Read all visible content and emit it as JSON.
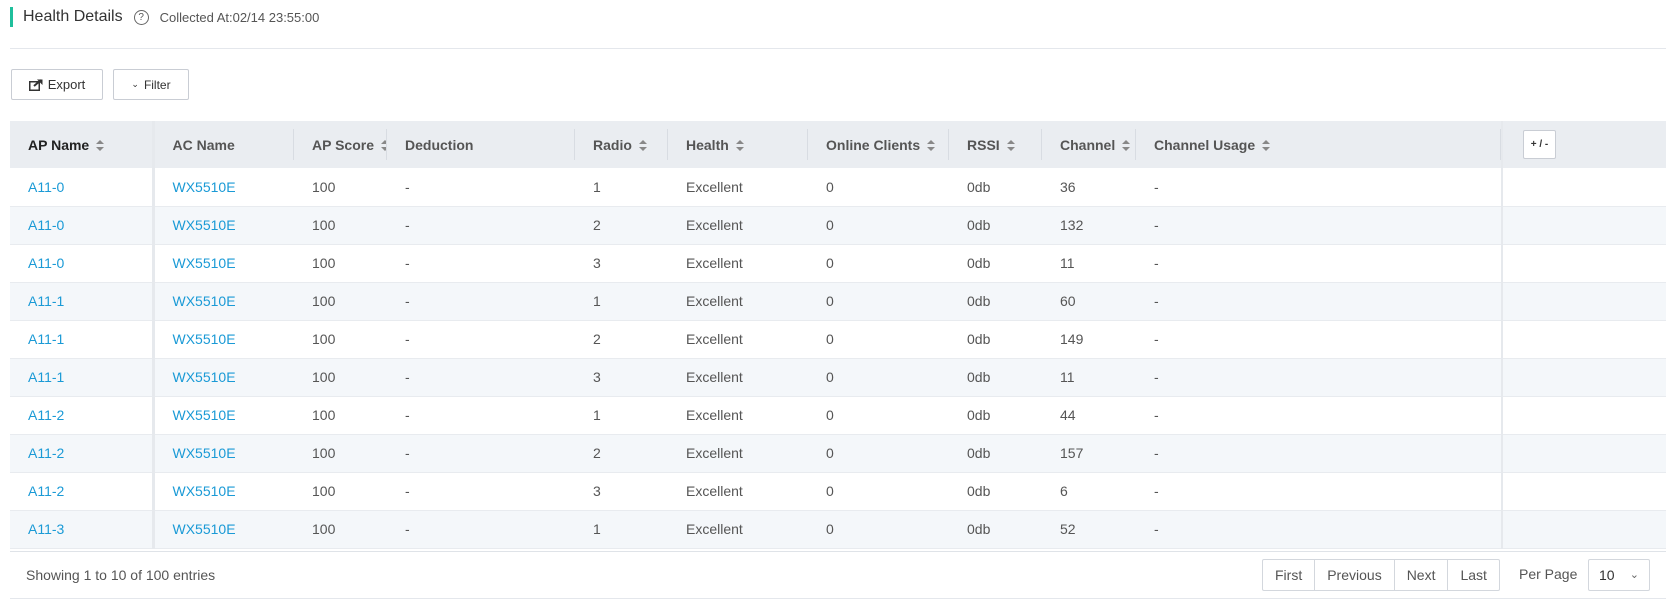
{
  "header": {
    "title": "Health Details",
    "help_glyph": "?",
    "collected": "Collected At:02/14 23:55:00"
  },
  "toolbar": {
    "export_label": "Export",
    "filter_label": "Filter"
  },
  "table": {
    "columns": [
      {
        "label": "AP Name",
        "sortable": true
      },
      {
        "label": "AC Name",
        "sortable": false
      },
      {
        "label": "AP Score",
        "sortable": true
      },
      {
        "label": "Deduction",
        "sortable": false
      },
      {
        "label": "Radio",
        "sortable": true
      },
      {
        "label": "Health",
        "sortable": true
      },
      {
        "label": "Online Clients",
        "sortable": true
      },
      {
        "label": "RSSI",
        "sortable": true
      },
      {
        "label": "Channel",
        "sortable": true
      },
      {
        "label": "Channel Usage",
        "sortable": true
      }
    ],
    "column_toggle_label": "+ / -",
    "rows": [
      {
        "ap": "A11-0",
        "ac": "WX5510E",
        "score": "100",
        "deduction": "-",
        "radio": "1",
        "health": "Excellent",
        "clients": "0",
        "rssi": "0db",
        "channel": "36",
        "usage": "-"
      },
      {
        "ap": "A11-0",
        "ac": "WX5510E",
        "score": "100",
        "deduction": "-",
        "radio": "2",
        "health": "Excellent",
        "clients": "0",
        "rssi": "0db",
        "channel": "132",
        "usage": "-"
      },
      {
        "ap": "A11-0",
        "ac": "WX5510E",
        "score": "100",
        "deduction": "-",
        "radio": "3",
        "health": "Excellent",
        "clients": "0",
        "rssi": "0db",
        "channel": "11",
        "usage": "-"
      },
      {
        "ap": "A11-1",
        "ac": "WX5510E",
        "score": "100",
        "deduction": "-",
        "radio": "1",
        "health": "Excellent",
        "clients": "0",
        "rssi": "0db",
        "channel": "60",
        "usage": "-"
      },
      {
        "ap": "A11-1",
        "ac": "WX5510E",
        "score": "100",
        "deduction": "-",
        "radio": "2",
        "health": "Excellent",
        "clients": "0",
        "rssi": "0db",
        "channel": "149",
        "usage": "-"
      },
      {
        "ap": "A11-1",
        "ac": "WX5510E",
        "score": "100",
        "deduction": "-",
        "radio": "3",
        "health": "Excellent",
        "clients": "0",
        "rssi": "0db",
        "channel": "11",
        "usage": "-"
      },
      {
        "ap": "A11-2",
        "ac": "WX5510E",
        "score": "100",
        "deduction": "-",
        "radio": "1",
        "health": "Excellent",
        "clients": "0",
        "rssi": "0db",
        "channel": "44",
        "usage": "-"
      },
      {
        "ap": "A11-2",
        "ac": "WX5510E",
        "score": "100",
        "deduction": "-",
        "radio": "2",
        "health": "Excellent",
        "clients": "0",
        "rssi": "0db",
        "channel": "157",
        "usage": "-"
      },
      {
        "ap": "A11-2",
        "ac": "WX5510E",
        "score": "100",
        "deduction": "-",
        "radio": "3",
        "health": "Excellent",
        "clients": "0",
        "rssi": "0db",
        "channel": "6",
        "usage": "-"
      },
      {
        "ap": "A11-3",
        "ac": "WX5510E",
        "score": "100",
        "deduction": "-",
        "radio": "1",
        "health": "Excellent",
        "clients": "0",
        "rssi": "0db",
        "channel": "52",
        "usage": "-"
      }
    ]
  },
  "footer": {
    "showing": "Showing 1 to 10 of 100 entries",
    "pager": [
      "First",
      "Previous",
      "Next",
      "Last"
    ],
    "per_page_label": "Per Page",
    "per_page_value": "10"
  },
  "colors": {
    "accent": "#1fbf9c",
    "link": "#1a9ad6",
    "header_bg": "#eaedf1",
    "stripe_bg": "#f4f7fa"
  }
}
